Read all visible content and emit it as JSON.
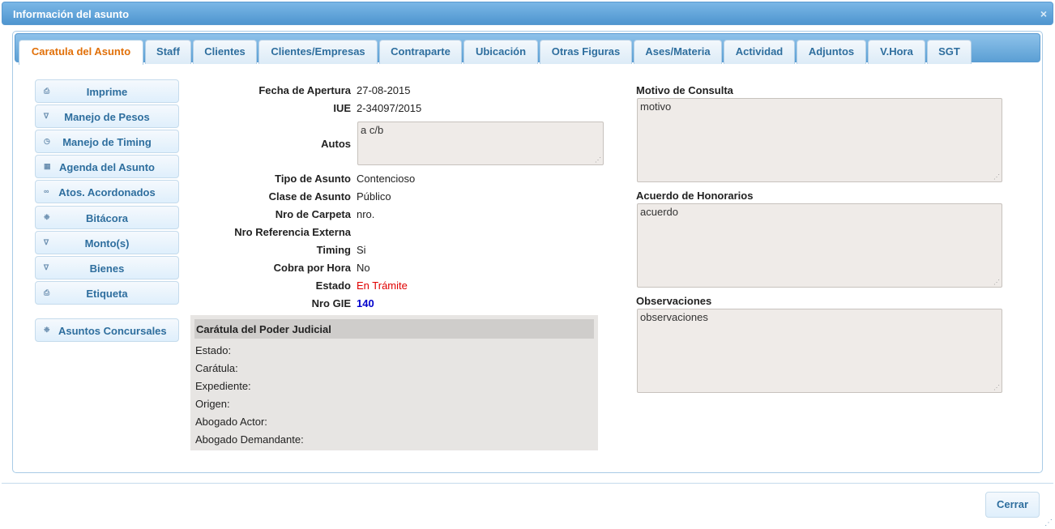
{
  "window": {
    "title": "Información del asunto",
    "close_glyph": "×"
  },
  "tabs": [
    {
      "label": "Caratula del Asunto",
      "active": true
    },
    {
      "label": "Staff"
    },
    {
      "label": "Clientes"
    },
    {
      "label": "Clientes/Empresas"
    },
    {
      "label": "Contraparte"
    },
    {
      "label": "Ubicación"
    },
    {
      "label": "Otras Figuras"
    },
    {
      "label": "Ases/Materia"
    },
    {
      "label": "Actividad"
    },
    {
      "label": "Adjuntos"
    },
    {
      "label": "V.Hora"
    },
    {
      "label": "SGT"
    }
  ],
  "sidebar": {
    "buttons": [
      {
        "label": "Imprime",
        "icon": "print-icon"
      },
      {
        "label": "Manejo de Pesos",
        "icon": "cart-icon"
      },
      {
        "label": "Manejo de Timing",
        "icon": "clock-icon"
      },
      {
        "label": "Agenda del Asunto",
        "icon": "calendar-icon"
      },
      {
        "label": "Atos. Acordonados",
        "icon": "link-icon"
      },
      {
        "label": "Bitácora",
        "icon": "gear-icon"
      },
      {
        "label": "Monto(s)",
        "icon": "cart-icon"
      },
      {
        "label": "Bienes",
        "icon": "cart-icon"
      },
      {
        "label": "Etiqueta",
        "icon": "print-icon"
      }
    ],
    "extra_button": {
      "label": "Asuntos Concursales",
      "icon": "gear-icon"
    }
  },
  "fields": {
    "fecha_apertura": {
      "label": "Fecha de Apertura",
      "value": "27-08-2015"
    },
    "iue": {
      "label": "IUE",
      "value": "2-34097/2015"
    },
    "autos": {
      "label": "Autos",
      "value": "a c/b"
    },
    "tipo_asunto": {
      "label": "Tipo de Asunto",
      "value": "Contencioso"
    },
    "clase_asunto": {
      "label": "Clase de Asunto",
      "value": "Público"
    },
    "nro_carpeta": {
      "label": "Nro de Carpeta",
      "value": "nro."
    },
    "nro_ref_externa": {
      "label": "Nro Referencia Externa",
      "value": ""
    },
    "timing": {
      "label": "Timing",
      "value": "Si"
    },
    "cobra_hora": {
      "label": "Cobra por Hora",
      "value": "No"
    },
    "estado": {
      "label": "Estado",
      "value": "En Trámite",
      "color": "#e00000"
    },
    "nro_gie": {
      "label": "Nro GIE",
      "value": "140",
      "color": "#0000cc"
    }
  },
  "judicial": {
    "title": "Carátula del Poder Judicial",
    "rows": [
      "Estado:",
      "Carátula:",
      "Expediente:",
      "Origen:",
      "Abogado Actor:",
      "Abogado Demandante:"
    ]
  },
  "right": {
    "motivo": {
      "label": "Motivo de Consulta",
      "value": "motivo"
    },
    "acuerdo": {
      "label": "Acuerdo de Honorarios",
      "value": "acuerdo"
    },
    "observaciones": {
      "label": "Observaciones",
      "value": "observaciones"
    }
  },
  "footer": {
    "close_label": "Cerrar"
  }
}
